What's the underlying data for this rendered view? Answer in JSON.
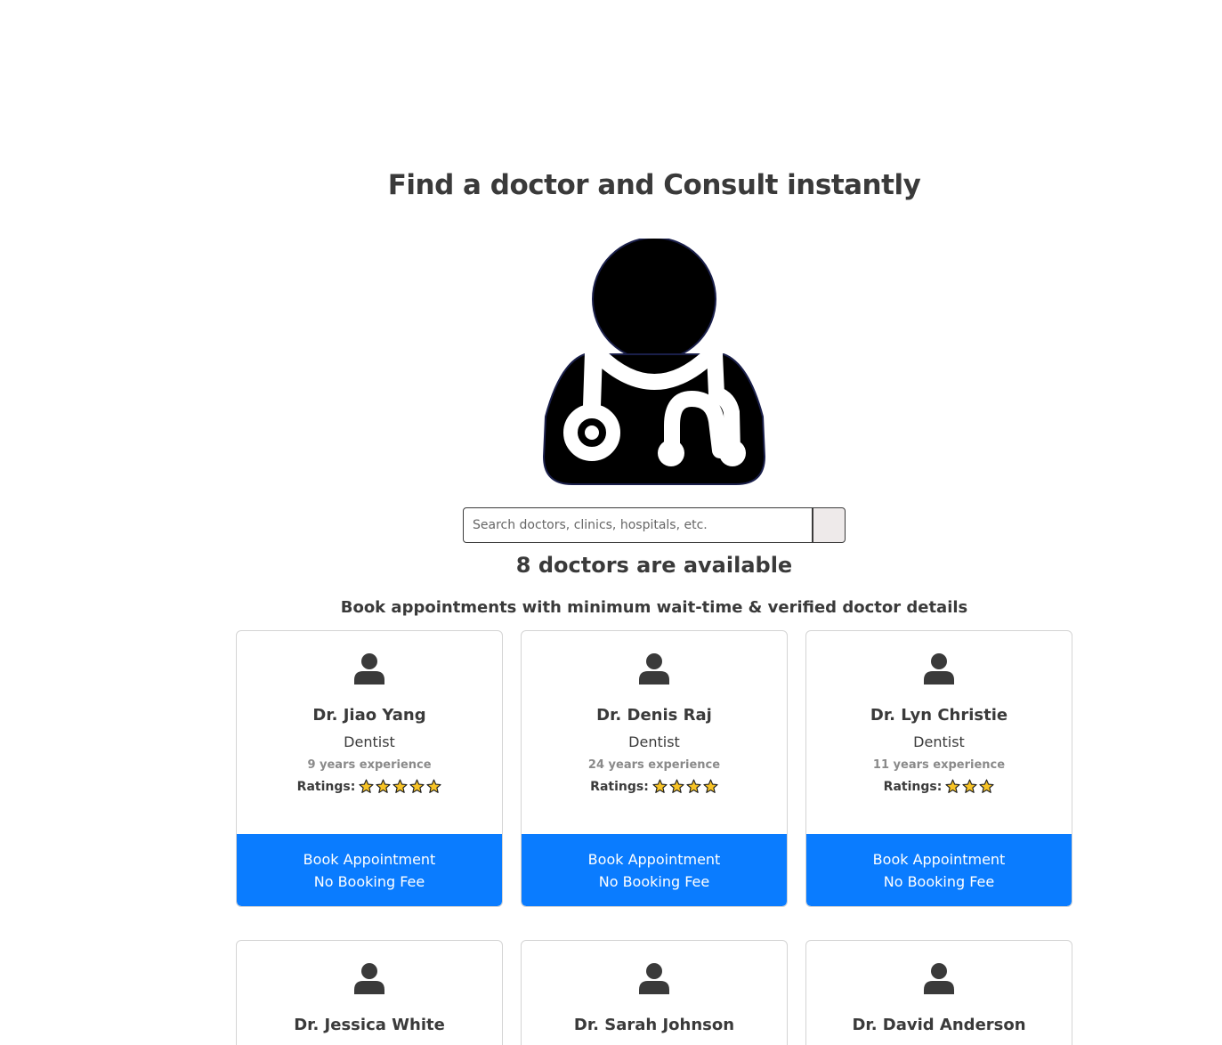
{
  "hero": {
    "title": "Find a doctor and Consult instantly",
    "icon": "doctor-stethoscope-icon"
  },
  "search": {
    "placeholder": "Search doctors, clinics, hospitals, etc.",
    "value": ""
  },
  "results": {
    "count_text": "8 doctors are available",
    "subtitle": "Book appointments with minimum wait-time & verified doctor details"
  },
  "colors": {
    "accent": "#0a7cff",
    "star": "#f7c325",
    "text": "#3a3a3a"
  },
  "doctors": [
    {
      "name": "Dr. Jiao Yang",
      "specialty": "Dentist",
      "experience": "9 years experience",
      "ratings_label": "Ratings:",
      "rating": 5,
      "book_label": "Book Appointment",
      "fee_label": "No Booking Fee"
    },
    {
      "name": "Dr. Denis Raj",
      "specialty": "Dentist",
      "experience": "24 years experience",
      "ratings_label": "Ratings:",
      "rating": 4,
      "book_label": "Book Appointment",
      "fee_label": "No Booking Fee"
    },
    {
      "name": "Dr. Lyn Christie",
      "specialty": "Dentist",
      "experience": "11 years experience",
      "ratings_label": "Ratings:",
      "rating": 3,
      "book_label": "Book Appointment",
      "fee_label": "No Booking Fee"
    },
    {
      "name": "Dr. Jessica White"
    },
    {
      "name": "Dr. Sarah Johnson"
    },
    {
      "name": "Dr. David Anderson"
    }
  ]
}
